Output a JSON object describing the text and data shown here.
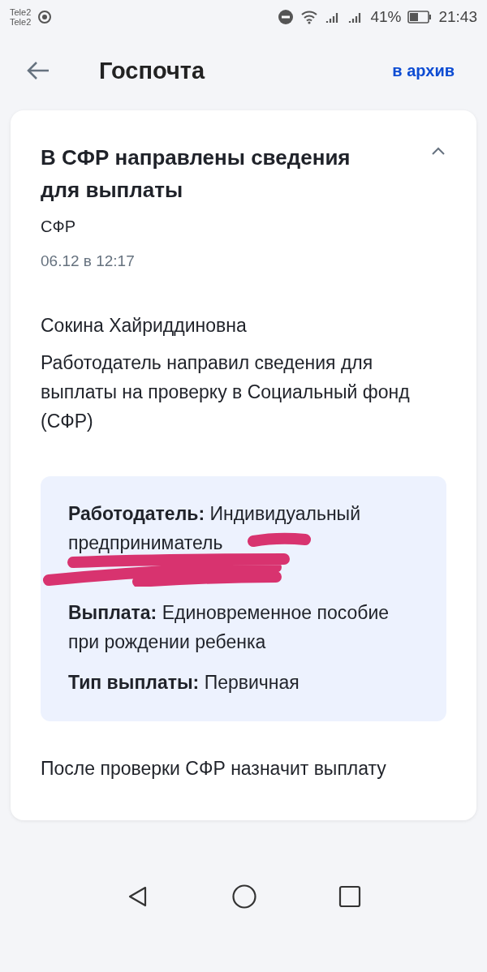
{
  "status_bar": {
    "carriers": [
      "Tele2",
      "Tele2"
    ],
    "battery": "41%",
    "time": "21:43"
  },
  "header": {
    "title": "Госпочта",
    "action": "в архив"
  },
  "message": {
    "title": "В СФР направлены сведения для выплаты",
    "expanded": true,
    "sender": "СФР",
    "date": "06.12 в 12:17",
    "recipient": "Сокина Хайриддиновна",
    "body": "Работодатель направил сведения для выплаты на проверку в Социальный фонд (СФР)",
    "details": [
      {
        "label": "Работодатель:",
        "value": "Индивидуальный предприниматель",
        "redacted": true
      },
      {
        "label": "Выплата:",
        "value": "Единовременное пособие при рождении ребенка",
        "redacted": false
      },
      {
        "label": "Тип выплаты:",
        "value": "Первичная",
        "redacted": false
      }
    ],
    "footer": "После проверки СФР назначит выплату"
  }
}
